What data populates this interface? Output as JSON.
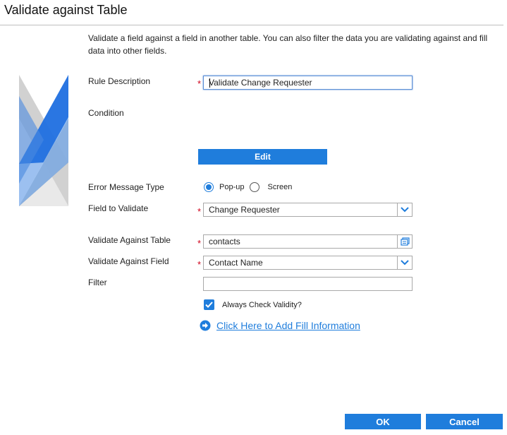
{
  "dialog": {
    "title": "Validate against Table",
    "intro": "Validate a field against a field in another table. You can also filter the data you are validating against and fill data into other fields."
  },
  "form": {
    "rule_description": {
      "label": "Rule Description",
      "value": "Validate Change Requester"
    },
    "condition": {
      "label": "Condition",
      "edit_label": "Edit"
    },
    "error_message_type": {
      "label": "Error Message Type",
      "option_popup": "Pop-up",
      "option_screen": "Screen",
      "selected": "Pop-up"
    },
    "field_to_validate": {
      "label": "Field to Validate",
      "value": "Change Requester"
    },
    "validate_against_table": {
      "label": "Validate Against Table",
      "value": "contacts"
    },
    "validate_against_field": {
      "label": "Validate Against Field",
      "value": "Contact Name"
    },
    "filter": {
      "label": "Filter",
      "value": ""
    },
    "always_check": {
      "label": "Always Check Validity?",
      "checked": true
    },
    "fill_link": "Click Here to Add Fill Information",
    "required_mark": "*"
  },
  "footer": {
    "ok_label": "OK",
    "cancel_label": "Cancel"
  },
  "colors": {
    "accent": "#1f7ddc",
    "required": "#d0021b"
  }
}
